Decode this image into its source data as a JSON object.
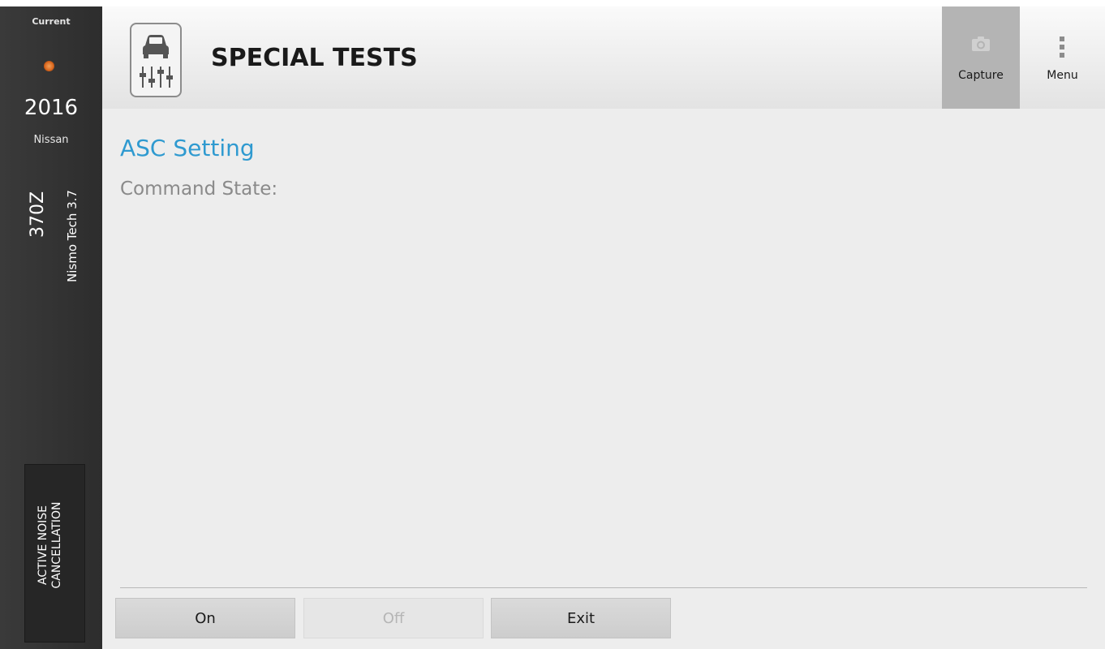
{
  "sidebar": {
    "current_label": "Current",
    "year": "2016",
    "make": "Nissan",
    "model": "370Z",
    "trim": "Nismo Tech 3.7",
    "status_color": "#d9661c",
    "system_button_label_line1": "ACTIVE NOISE",
    "system_button_label_line2": "CANCELLATION"
  },
  "header": {
    "icon": "car-test-sliders-icon",
    "title": "SPECIAL TESTS",
    "capture_label": "Capture",
    "capture_icon": "camera-icon",
    "menu_label": "Menu",
    "menu_icon": "vertical-dots-icon"
  },
  "content": {
    "title": "ASC Setting",
    "subtitle": "Command State:",
    "accent_color": "#2f9ad0"
  },
  "buttons": [
    {
      "label": "On",
      "enabled": true
    },
    {
      "label": "Off",
      "enabled": false
    },
    {
      "label": "Exit",
      "enabled": true
    }
  ]
}
